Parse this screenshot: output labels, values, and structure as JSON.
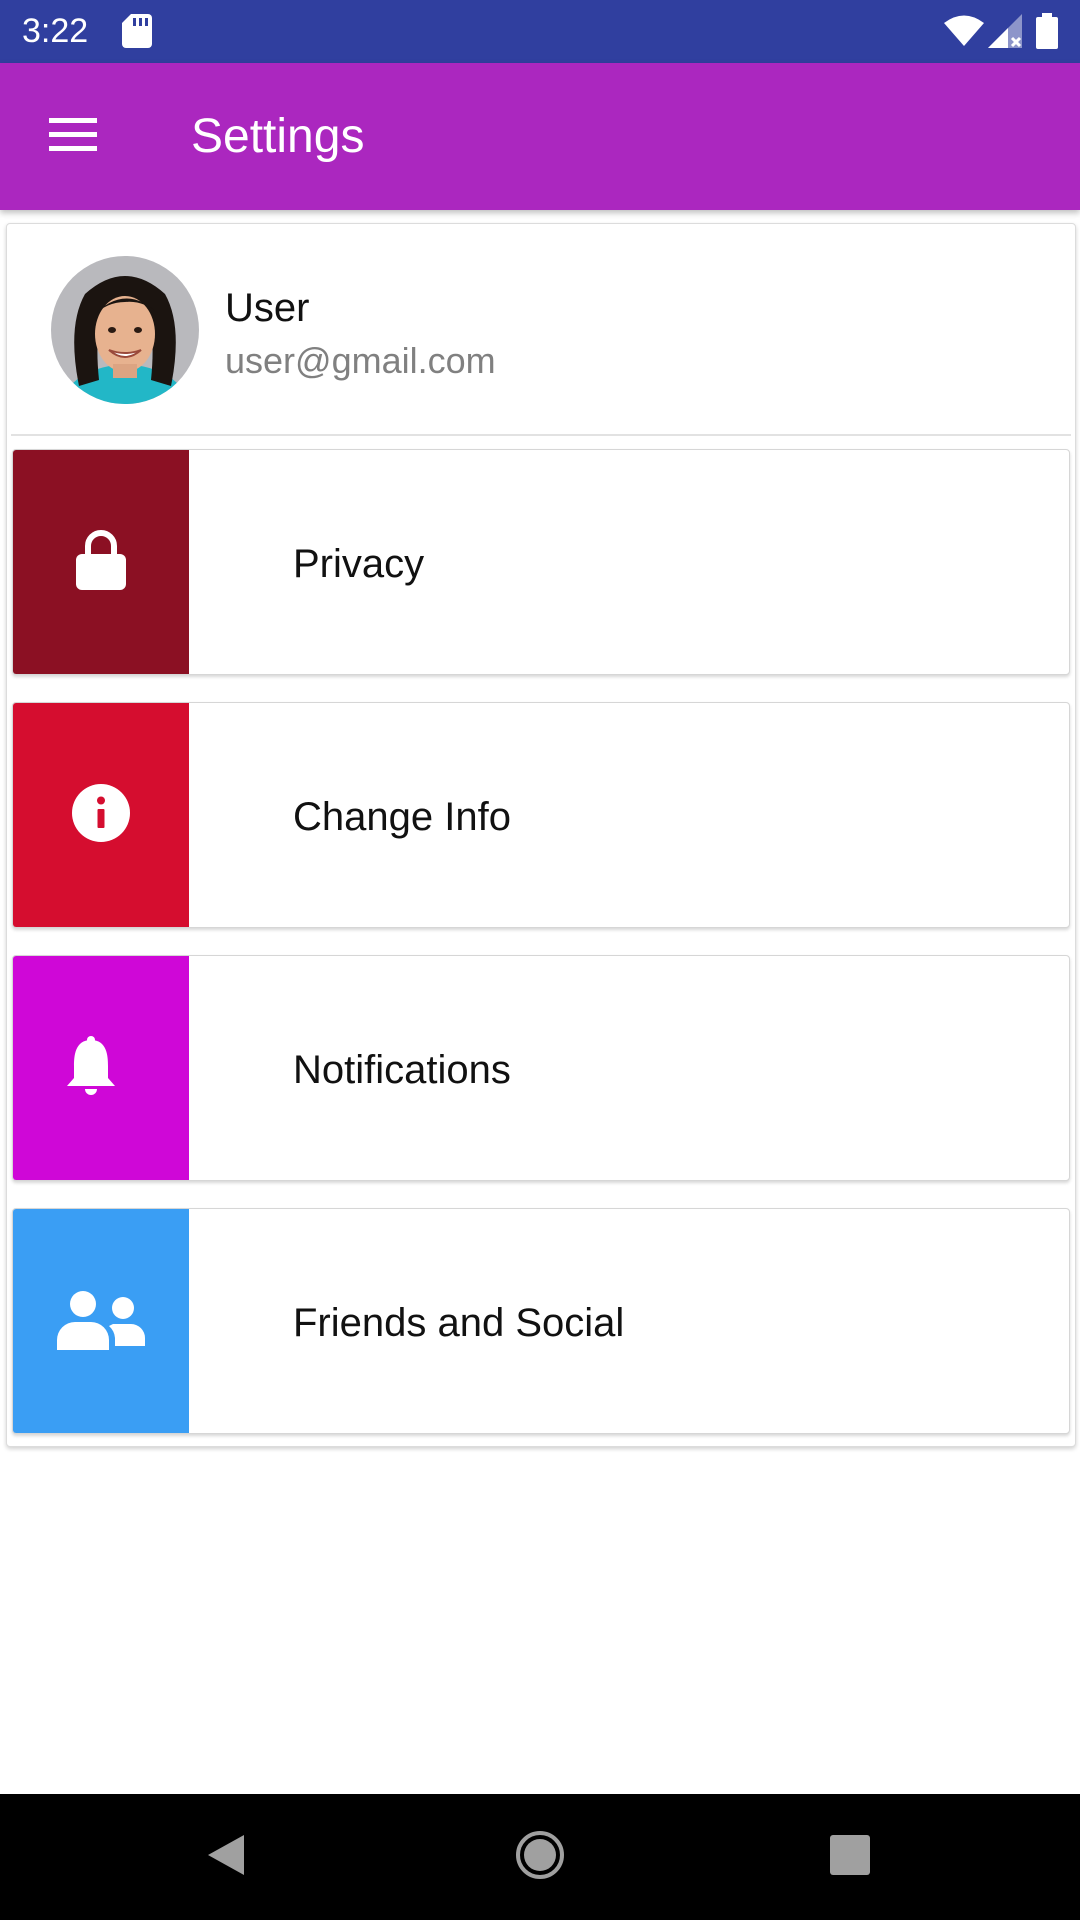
{
  "status_bar": {
    "time": "3:22",
    "icons": [
      "sd-card-icon",
      "wifi-icon",
      "signal-icon",
      "battery-icon"
    ]
  },
  "app_bar": {
    "title": "Settings",
    "menu_icon": "menu-icon",
    "color": "#AB27BF"
  },
  "profile": {
    "name": "User",
    "email": "user@gmail.com"
  },
  "settings": [
    {
      "label": "Privacy",
      "icon": "lock-icon",
      "color": "#8B1023"
    },
    {
      "label": "Change Info",
      "icon": "info-icon",
      "color": "#D50D2F"
    },
    {
      "label": "Notifications",
      "icon": "bell-icon",
      "color": "#CF07D7"
    },
    {
      "label": "Friends and Social",
      "icon": "people-icon",
      "color": "#3A9EF4"
    }
  ],
  "nav_bar": {
    "icons": [
      "back-icon",
      "home-icon",
      "recents-icon"
    ]
  }
}
